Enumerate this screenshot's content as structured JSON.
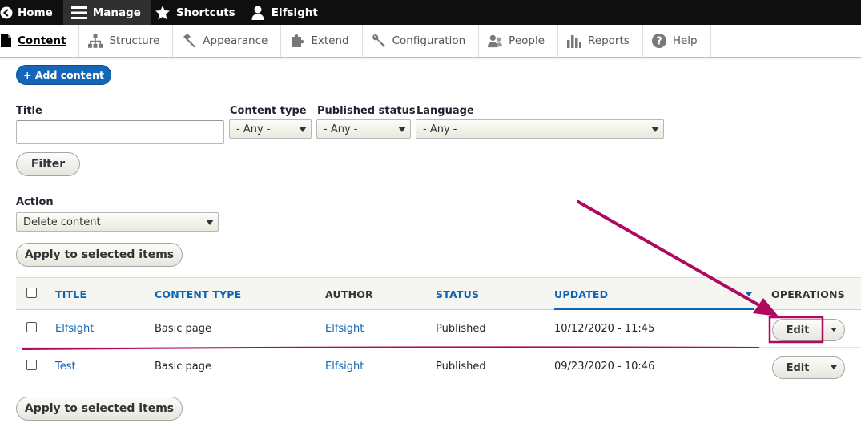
{
  "toolbar": {
    "home": "Home",
    "manage": "Manage",
    "shortcuts": "Shortcuts",
    "user": "Elfsight"
  },
  "tray": {
    "items": [
      "Content",
      "Structure",
      "Appearance",
      "Extend",
      "Configuration",
      "People",
      "Reports",
      "Help"
    ]
  },
  "add_content": "+ Add content",
  "filters": {
    "title_label": "Title",
    "title_value": "",
    "content_type_label": "Content type",
    "content_type_value": "- Any -",
    "published_label": "Published status",
    "published_value": "- Any -",
    "language_label": "Language",
    "language_value": "- Any -",
    "filter_button": "Filter"
  },
  "action": {
    "label": "Action",
    "value": "Delete content",
    "apply_label": "Apply to selected items"
  },
  "table": {
    "headers": [
      "TITLE",
      "CONTENT TYPE",
      "AUTHOR",
      "STATUS",
      "UPDATED",
      "OPERATIONS"
    ],
    "rows": [
      {
        "title": "Elfsight",
        "type": "Basic page",
        "author": "Elfsight",
        "status": "Published",
        "updated": "10/12/2020 - 11:45",
        "op": "Edit"
      },
      {
        "title": "Test",
        "type": "Basic page",
        "author": "Elfsight",
        "status": "Published",
        "updated": "09/23/2020 - 10:46",
        "op": "Edit"
      }
    ]
  },
  "colors": {
    "annotation": "#b0075f",
    "link": "#0e64b4",
    "primary_button": "#1565b8"
  }
}
